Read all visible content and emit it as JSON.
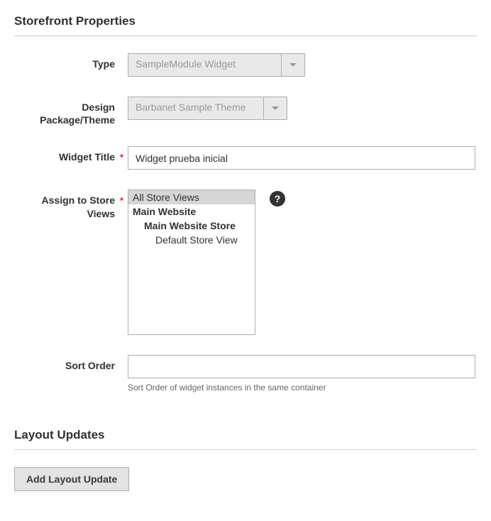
{
  "section1": {
    "title": "Storefront Properties"
  },
  "type": {
    "label": "Type",
    "value": "SampleModule Widget"
  },
  "theme": {
    "label": "Design Package/Theme",
    "value": "Barbanet Sample Theme"
  },
  "widget_title": {
    "label": "Widget Title",
    "value": "Widget prueba inicial"
  },
  "store_views": {
    "label": "Assign to Store Views",
    "options": {
      "all": "All Store Views",
      "main_website": "Main Website",
      "main_store": "Main Website Store",
      "default_view": "Default Store View"
    },
    "tooltip": "?"
  },
  "sort_order": {
    "label": "Sort Order",
    "value": "",
    "note": "Sort Order of widget instances in the same container"
  },
  "section2": {
    "title": "Layout Updates"
  },
  "add_layout": {
    "label": "Add Layout Update"
  }
}
